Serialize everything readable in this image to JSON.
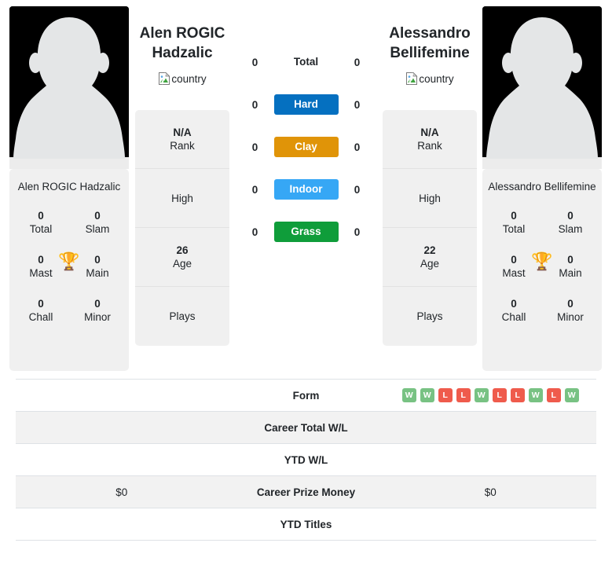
{
  "players": {
    "left": {
      "name": "Alen ROGIC Hadzalic",
      "name_lines": [
        "Alen ROGIC",
        "Hadzalic"
      ],
      "country_alt": "country",
      "card_name": "Alen ROGIC Hadzalic",
      "titles": [
        {
          "value": "0",
          "label": "Total"
        },
        {
          "value": "0",
          "label": "Slam"
        },
        {
          "value": "0",
          "label": "Mast"
        },
        {
          "value": "0",
          "label": "Main"
        },
        {
          "value": "0",
          "label": "Chall"
        },
        {
          "value": "0",
          "label": "Minor"
        }
      ],
      "info": [
        {
          "value": "N/A",
          "label": "Rank"
        },
        {
          "value": "",
          "label": "High"
        },
        {
          "value": "26",
          "label": "Age"
        },
        {
          "value": "",
          "label": "Plays"
        }
      ],
      "surface_scores": [
        "0",
        "0",
        "0",
        "0",
        "0"
      ],
      "career_total_wl": "",
      "ytd_wl": "",
      "career_prize_money": "$0",
      "ytd_titles": "",
      "form": []
    },
    "right": {
      "name": "Alessandro Bellifemine",
      "name_lines": [
        "Alessandro",
        "Bellifemine"
      ],
      "country_alt": "country",
      "card_name": "Alessandro Bellifemine",
      "titles": [
        {
          "value": "0",
          "label": "Total"
        },
        {
          "value": "0",
          "label": "Slam"
        },
        {
          "value": "0",
          "label": "Mast"
        },
        {
          "value": "0",
          "label": "Main"
        },
        {
          "value": "0",
          "label": "Chall"
        },
        {
          "value": "0",
          "label": "Minor"
        }
      ],
      "info": [
        {
          "value": "N/A",
          "label": "Rank"
        },
        {
          "value": "",
          "label": "High"
        },
        {
          "value": "22",
          "label": "Age"
        },
        {
          "value": "",
          "label": "Plays"
        }
      ],
      "surface_scores": [
        "0",
        "0",
        "0",
        "0",
        "0"
      ],
      "career_total_wl": "",
      "ytd_wl": "",
      "career_prize_money": "$0",
      "ytd_titles": "",
      "form": [
        "W",
        "W",
        "L",
        "L",
        "W",
        "L",
        "L",
        "W",
        "L",
        "W"
      ]
    }
  },
  "surfaces": [
    {
      "label": "Total",
      "color": "transparent",
      "plain": true
    },
    {
      "label": "Hard",
      "color": "#0570c0",
      "plain": false
    },
    {
      "label": "Clay",
      "color": "#e09408",
      "plain": false
    },
    {
      "label": "Indoor",
      "color": "#36a7f5",
      "plain": false
    },
    {
      "label": "Grass",
      "color": "#0f9d3a",
      "plain": false
    }
  ],
  "table": {
    "form_label": "Form",
    "career_total_wl_label": "Career Total W/L",
    "ytd_wl_label": "YTD W/L",
    "career_prize_money_label": "Career Prize Money",
    "ytd_titles_label": "YTD Titles"
  },
  "colors": {
    "win": "#78c283",
    "loss": "#ef5b4c",
    "card_bg": "#f0f0f0",
    "stripe_bg": "#f2f2f2",
    "trophy": "#3d6fa8"
  },
  "icons": {
    "trophy": "🏆"
  }
}
